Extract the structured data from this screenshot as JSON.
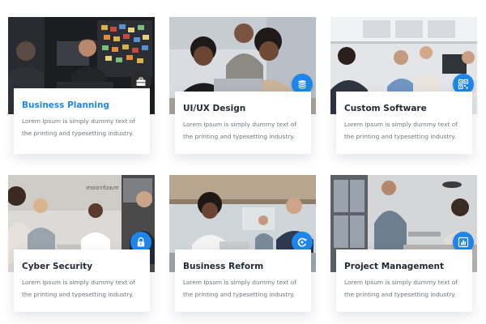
{
  "cards": [
    {
      "title": "Business Planning",
      "desc": "Lorem Ipsum is simply dummy text of the printing and typesetting industry.",
      "icon": "briefcase-icon",
      "active": true
    },
    {
      "title": "UI/UX Design",
      "desc": "Lorem Ipsum is simply dummy text of the printing and typesetting industry.",
      "icon": "coins-icon",
      "active": false
    },
    {
      "title": "Custom Software",
      "desc": "Lorem Ipsum is simply dummy text of the printing and typesetting industry.",
      "icon": "qr-code-icon",
      "active": false
    },
    {
      "title": "Cyber Security",
      "desc": "Lorem Ipsum is simply dummy text of the printing and typesetting industry.",
      "icon": "lock-icon",
      "active": false
    },
    {
      "title": "Business Reform",
      "desc": "Lorem Ipsum is simply dummy text of the printing and typesetting industry.",
      "icon": "refresh-icon",
      "active": false
    },
    {
      "title": "Project Management",
      "desc": "Lorem Ipsum is simply dummy text of the printing and typesetting industry.",
      "icon": "bar-chart-icon",
      "active": false
    }
  ],
  "wall_sign": "mashroom",
  "colors": {
    "accent": "#1e86ea",
    "dark_badge": "#2b2b2b",
    "title": "#222a35",
    "text": "#6f7680"
  }
}
